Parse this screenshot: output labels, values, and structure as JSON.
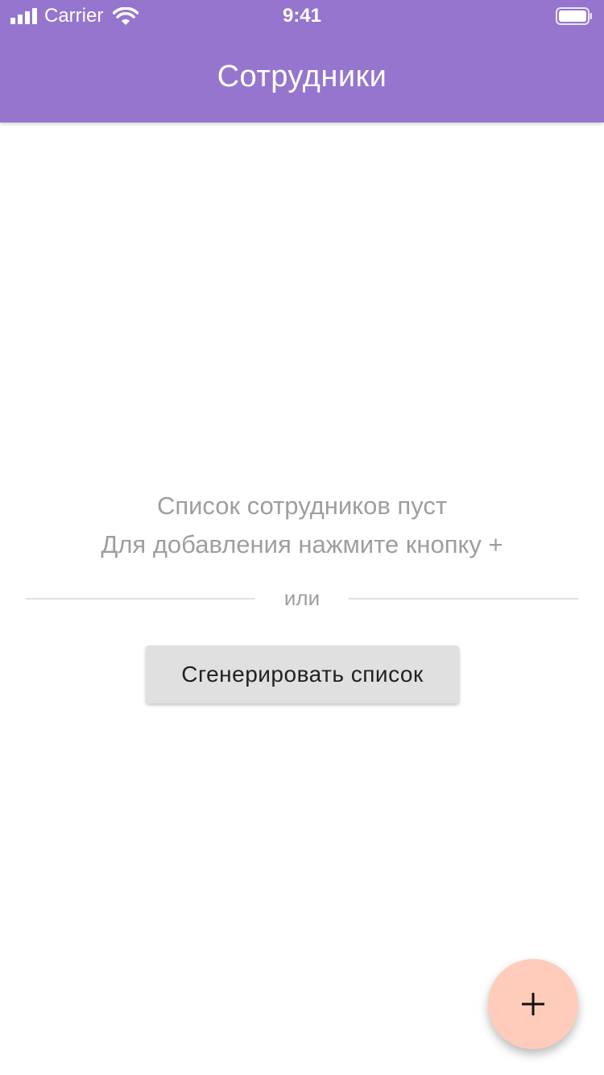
{
  "status_bar": {
    "carrier": "Carrier",
    "time": "9:41",
    "signal_icon": "cellular-signal-icon",
    "wifi_icon": "wifi-icon",
    "battery_icon": "battery-icon"
  },
  "app_bar": {
    "title": "Сотрудники",
    "background_color": "#9575cd"
  },
  "empty_state": {
    "title": "Список сотрудников пуст",
    "hint": "Для добавления нажмите кнопку +",
    "divider_text": "или",
    "generate_button_label": "Сгенерировать список"
  },
  "fab": {
    "icon": "plus-icon",
    "background_color": "#ffccbc"
  }
}
